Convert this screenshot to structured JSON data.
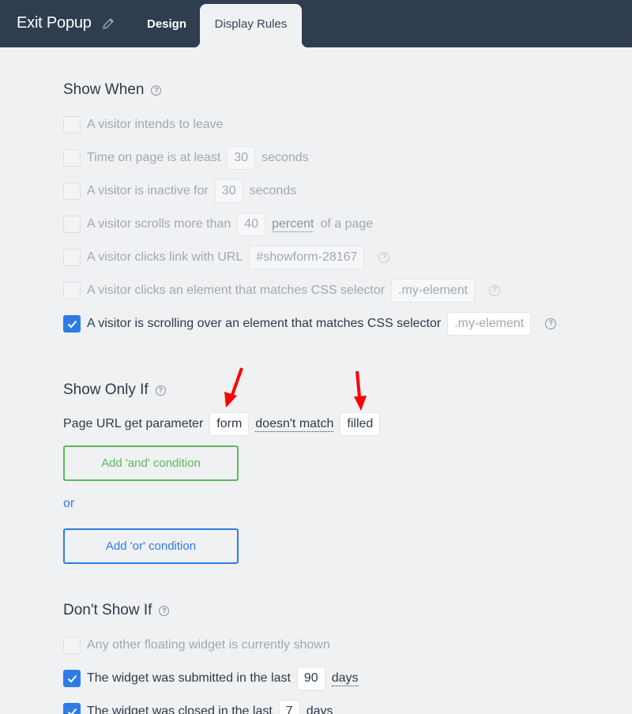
{
  "header": {
    "title": "Exit Popup",
    "tabs": [
      {
        "label": "Design",
        "active": false
      },
      {
        "label": "Display Rules",
        "active": true
      }
    ]
  },
  "colors": {
    "header_bg": "#2f3d4f",
    "page_bg": "#f0f1f3",
    "accent_blue": "#2d7be5",
    "accent_green": "#5cb85c",
    "annotation_red": "#ff0000"
  },
  "show_when": {
    "title": "Show When",
    "rules": [
      {
        "checked": false,
        "text": "A visitor intends to leave"
      },
      {
        "checked": false,
        "text": "Time on page is at least",
        "value": "30",
        "suffix": "seconds"
      },
      {
        "checked": false,
        "text": "A visitor is inactive for",
        "value": "30",
        "suffix": "seconds"
      },
      {
        "checked": false,
        "text": "A visitor scrolls more than",
        "value": "40",
        "unit": "percent",
        "suffix": "of a page"
      },
      {
        "checked": false,
        "text": "A visitor clicks link with URL",
        "value": "#showform-28167"
      },
      {
        "checked": false,
        "text": "A visitor clicks an element that matches CSS selector",
        "placeholder": ".my-element"
      },
      {
        "checked": true,
        "text": "A visitor is scrolling over an element that matches CSS selector",
        "placeholder": ".my-element"
      }
    ]
  },
  "show_only_if": {
    "title": "Show Only If",
    "condition": {
      "label": "Page URL get parameter",
      "param": "form",
      "operator": "doesn't match",
      "value": "filled"
    },
    "add_and_label": "Add 'and' condition",
    "or_label": "or",
    "add_or_label": "Add 'or' condition"
  },
  "dont_show_if": {
    "title": "Don't Show If",
    "rules": [
      {
        "checked": false,
        "text": "Any other floating widget is currently shown"
      },
      {
        "checked": true,
        "text": "The widget was submitted in the last",
        "value": "90",
        "unit": "days"
      },
      {
        "checked": true,
        "text": "The widget was closed in the last",
        "value": "7",
        "unit": "days"
      }
    ]
  }
}
